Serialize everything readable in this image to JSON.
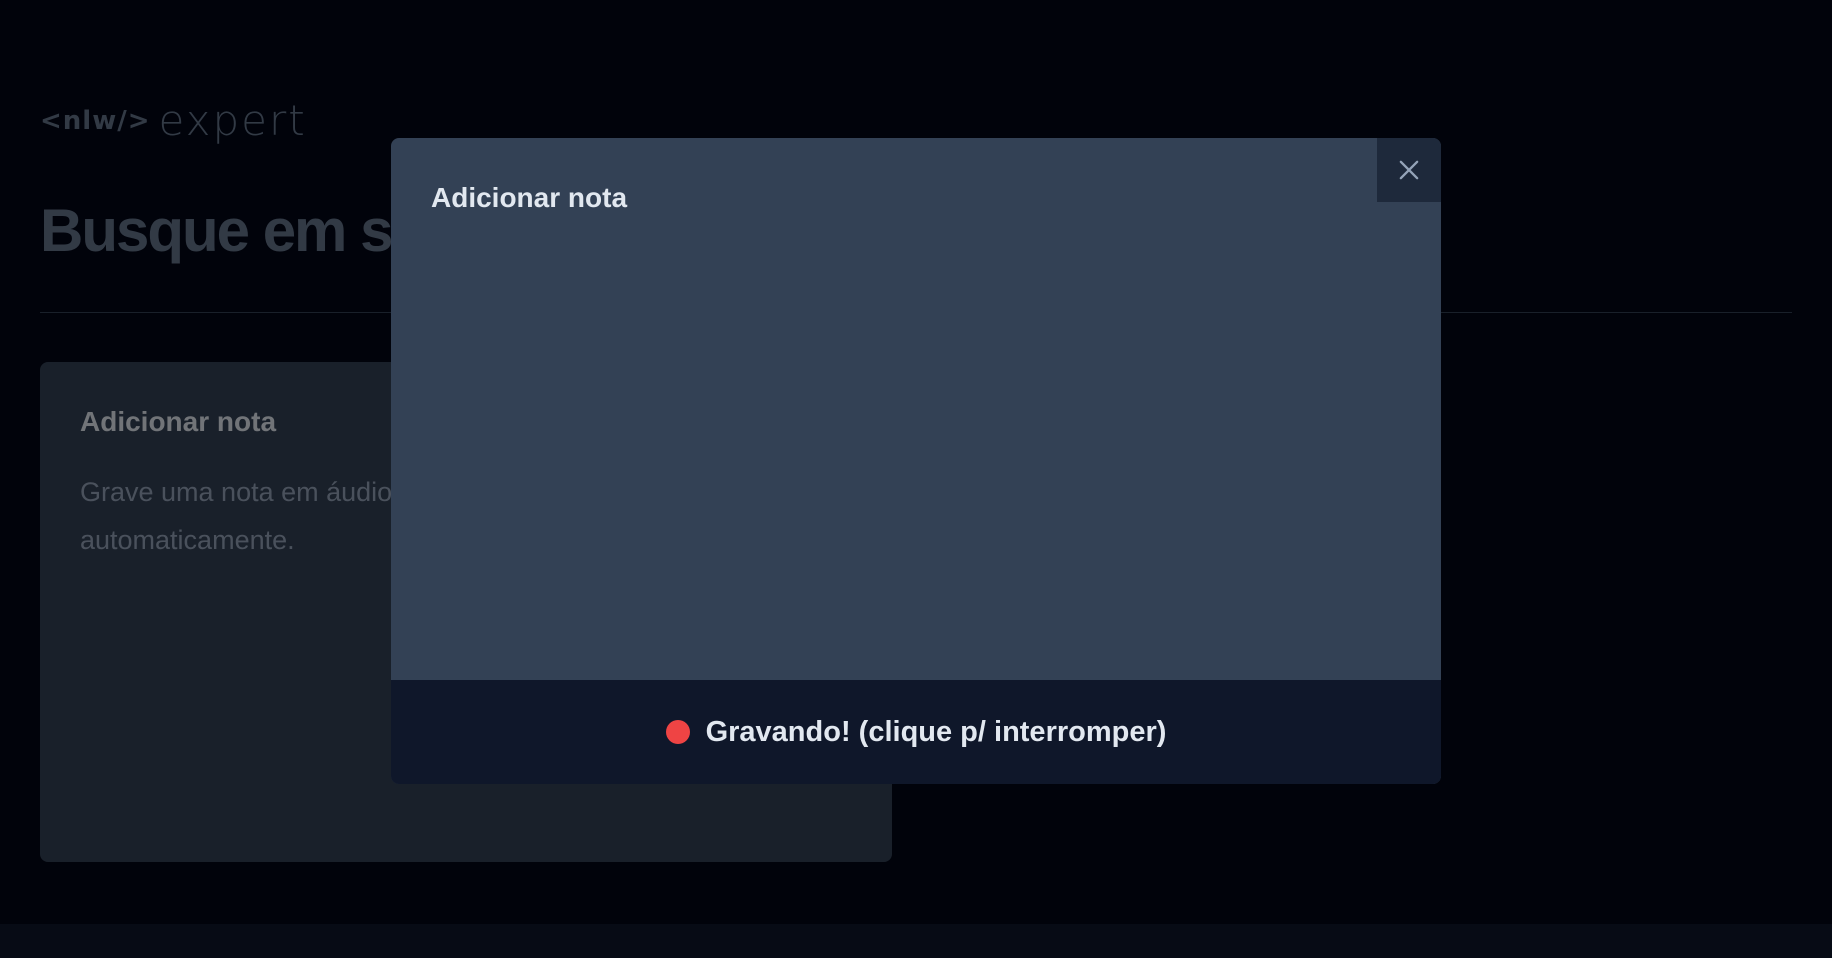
{
  "logo": {
    "nlw": "<nlw/>",
    "expert": "expert"
  },
  "search": {
    "placeholder": "Busque em suas notas..."
  },
  "card": {
    "title": "Adicionar nota",
    "description": "Grave uma nota em áudio que será convertida para texto automaticamente."
  },
  "modal": {
    "title": "Adicionar nota",
    "close_icon": "close-icon",
    "recording_label": "Gravando! (clique p/ interromper)",
    "recording_indicator_color": "#ef4444"
  }
}
